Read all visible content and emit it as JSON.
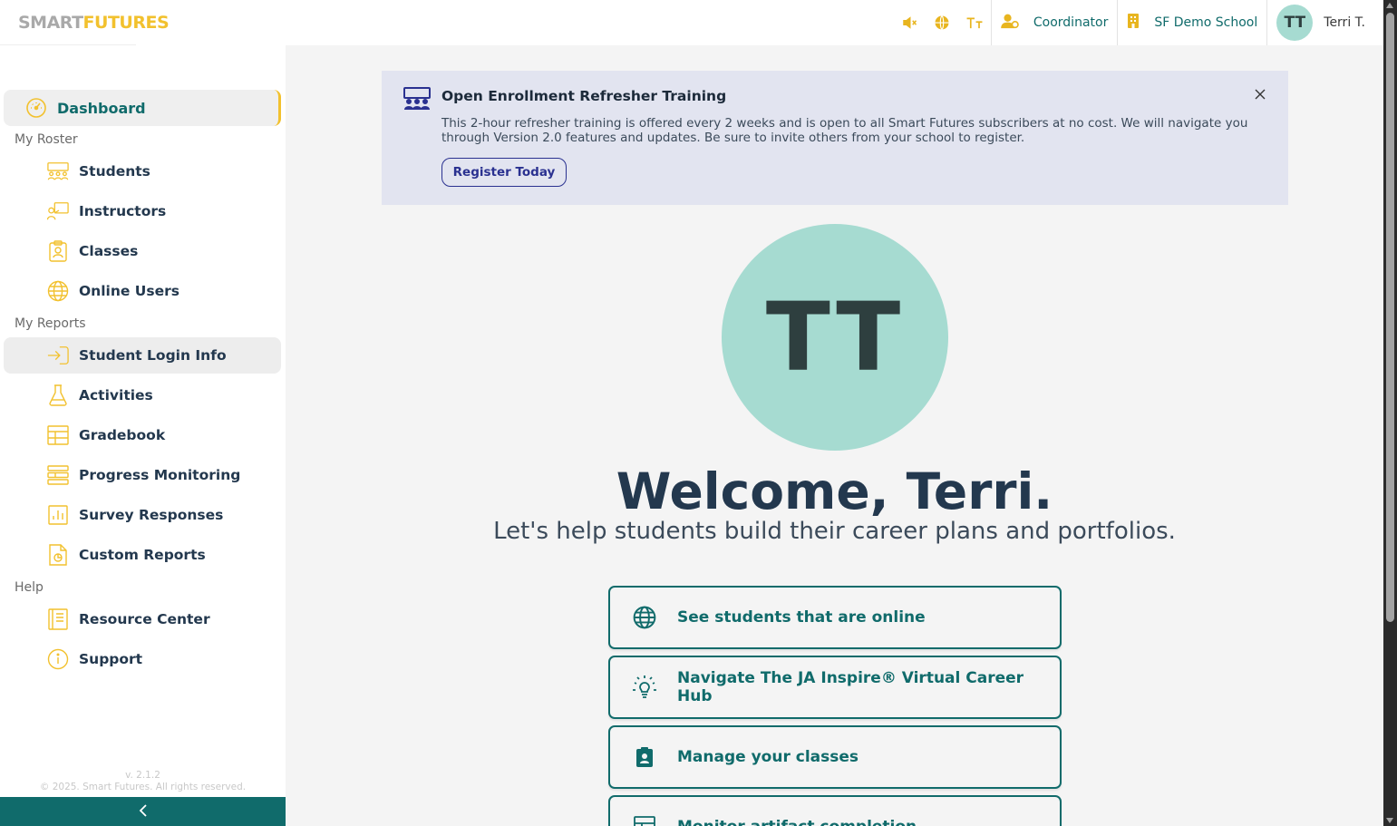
{
  "header": {
    "logo_part1": "SMART",
    "logo_part2": "FUTURES",
    "role": "Coordinator",
    "school": "SF Demo School",
    "avatar_initials": "TT",
    "user_name": "Terri T."
  },
  "sidebar": {
    "dashboard": "Dashboard",
    "sections": {
      "roster": "My Roster",
      "reports": "My Reports",
      "help": "Help"
    },
    "roster_items": [
      "Students",
      "Instructors",
      "Classes",
      "Online Users"
    ],
    "report_items": [
      "Student Login Info",
      "Activities",
      "Gradebook",
      "Progress Monitoring",
      "Survey Responses",
      "Custom Reports"
    ],
    "help_items": [
      "Resource Center",
      "Support"
    ],
    "version": "v. 2.1.2",
    "copyright": "© 2025. Smart Futures. All rights reserved."
  },
  "banner": {
    "title": "Open Enrollment Refresher Training",
    "body": "This 2-hour refresher training is offered every 2 weeks and is open to all Smart Futures subscribers at no cost. We will navigate you through Version 2.0 features and updates. Be sure to invite others from your school to register.",
    "button": "Register Today"
  },
  "main": {
    "avatar_initials": "TT",
    "welcome": "Welcome, Terri.",
    "tagline": "Let's help students build their career plans and portfolios.",
    "actions": [
      "See students that are online",
      "Navigate The JA Inspire® Virtual Career Hub",
      "Manage your classes",
      "Monitor artifact completion"
    ]
  },
  "colors": {
    "accent_yellow": "#f2c12e",
    "teal": "#106b6b",
    "avatar_mint": "#a6dbd1",
    "navy": "#23384e",
    "banner_bg": "#e2e4f0",
    "banner_button": "#2a3190"
  }
}
